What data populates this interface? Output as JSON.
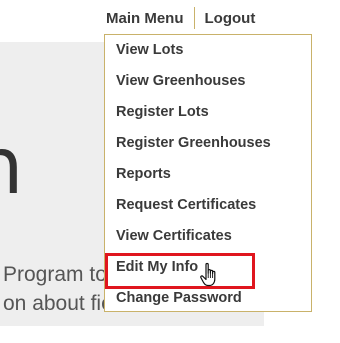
{
  "nav": {
    "main_menu_label": "Main Menu",
    "logout_label": "Logout"
  },
  "hero": {
    "big_text": "n",
    "line1": "Program to",
    "line2": "on about fie"
  },
  "menu": {
    "items": [
      {
        "label": "View Lots"
      },
      {
        "label": "View Greenhouses"
      },
      {
        "label": "Register Lots"
      },
      {
        "label": "Register Greenhouses"
      },
      {
        "label": "Reports"
      },
      {
        "label": "Request Certificates"
      },
      {
        "label": "View Certificates"
      },
      {
        "label": "Edit My Info"
      },
      {
        "label": "Change Password"
      }
    ],
    "highlighted": "Edit My Info"
  },
  "colors": {
    "accent_border": "#c9b26a",
    "highlight_border": "#e0161e",
    "hero_background": "#eeeeee",
    "text": "#3a3a3a"
  },
  "icons": {
    "cursor": "hand-pointer-icon"
  }
}
